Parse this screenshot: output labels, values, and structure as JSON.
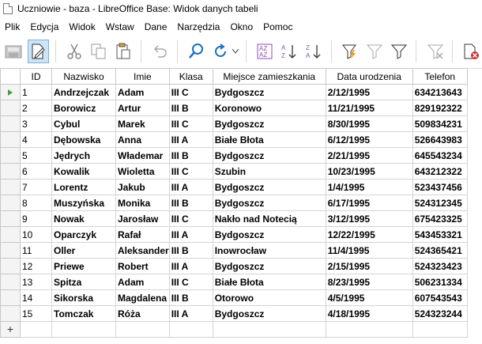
{
  "window": {
    "title": "Uczniowie - baza - LibreOffice Base: Widok danych tabeli"
  },
  "menu": [
    {
      "label": "Plik"
    },
    {
      "label": "Edycja"
    },
    {
      "label": "Widok"
    },
    {
      "label": "Wstaw"
    },
    {
      "label": "Dane"
    },
    {
      "label": "Narzędzia"
    },
    {
      "label": "Okno"
    },
    {
      "label": "Pomoc"
    }
  ],
  "toolbar": [
    {
      "icon": "save-record-icon"
    },
    {
      "icon": "edit-data-icon",
      "active": true
    },
    {
      "icon": "cut-icon"
    },
    {
      "icon": "copy-icon"
    },
    {
      "icon": "paste-icon"
    },
    {
      "icon": "undo-icon"
    },
    {
      "icon": "find-record-icon"
    },
    {
      "icon": "refresh-icon"
    },
    {
      "icon": "sort-icon"
    },
    {
      "icon": "sort-ascending-icon"
    },
    {
      "icon": "sort-descending-icon"
    },
    {
      "icon": "autofilter-icon"
    },
    {
      "icon": "apply-filter-icon"
    },
    {
      "icon": "standard-filter-icon"
    },
    {
      "icon": "reset-filter-icon"
    },
    {
      "icon": "delete-record-icon"
    }
  ],
  "table": {
    "columns": [
      "ID",
      "Nazwisko",
      "Imie",
      "Klasa",
      "Miejsce zamieszkania",
      "Data urodzenia",
      "Telefon"
    ],
    "rows": [
      [
        "1",
        "Andrzejczak",
        "Adam",
        "III C",
        "Bydgoszcz",
        "2/12/1995",
        "634213643"
      ],
      [
        "2",
        "Borowicz",
        "Artur",
        "III B",
        "Koronowo",
        "11/21/1995",
        "829192322"
      ],
      [
        "3",
        "Cybul",
        "Marek",
        "III C",
        "Bydgoszcz",
        "8/30/1995",
        "509834231"
      ],
      [
        "4",
        "Dębowska",
        "Anna",
        "III A",
        "Białe Błota",
        "6/12/1995",
        "526643983"
      ],
      [
        "5",
        "Jędrych",
        "Włademar",
        "III B",
        "Bydgoszcz",
        "2/21/1995",
        "645543234"
      ],
      [
        "6",
        "Kowalik",
        "Wioletta",
        "III C",
        "Szubin",
        "10/23/1995",
        "643212322"
      ],
      [
        "7",
        "Lorentz",
        "Jakub",
        "III A",
        "Bydgoszcz",
        "1/4/1995",
        "523437456"
      ],
      [
        "8",
        "Muszyńska",
        "Monika",
        "III B",
        "Bydgoszcz",
        "6/17/1995",
        "524312345"
      ],
      [
        "9",
        "Nowak",
        "Jarosław",
        "III C",
        "Nakło nad Notecią",
        "3/12/1995",
        "675423325"
      ],
      [
        "10",
        "Oparczyk",
        "Rafał",
        "III A",
        "Bydgoszcz",
        "12/22/1995",
        "543453321"
      ],
      [
        "11",
        "Oller",
        "Aleksander",
        "III B",
        "Inowrocław",
        "11/4/1995",
        "524365421"
      ],
      [
        "12",
        "Priewe",
        "Robert",
        "III A",
        "Bydgoszcz",
        "2/15/1995",
        "524323423"
      ],
      [
        "13",
        "Spitza",
        "Adam",
        "III C",
        "Białe Błota",
        "8/23/1995",
        "506231334"
      ],
      [
        "14",
        "Sikorska",
        "Magdalena",
        "III B",
        "Otorowo",
        "4/5/1995",
        "607543543"
      ],
      [
        "15",
        "Tomczak",
        "Róża",
        "III A",
        "Bydgoszcz",
        "4/18/1995",
        "524323244"
      ]
    ],
    "current_row": 0,
    "new_row_marker": "+"
  },
  "colors": {
    "accent_active_bg": "#cfe3f7",
    "current_row_arrow": "#4aa03c",
    "filter_icon_orange": "#e8a020",
    "delete_icon_red": "#d03030"
  }
}
